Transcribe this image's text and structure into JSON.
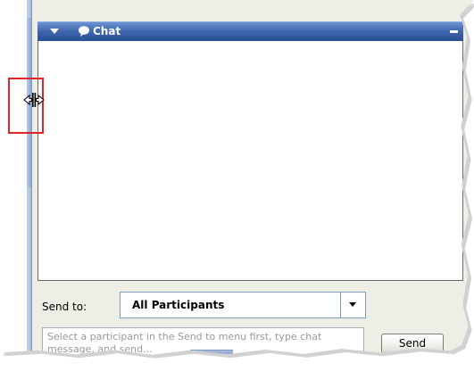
{
  "chat_panel": {
    "title": "Chat",
    "title_icon": "speech-bubble-icon",
    "collapse_icon": "triangle-down-icon",
    "minimize_icon": "minimize-icon"
  },
  "footer": {
    "send_to_label": "Send to:",
    "send_to_value": "All Participants",
    "dropdown_icon": "chevron-down-icon",
    "message_placeholder": "Select a participant in the Send to menu first, type chat message, and send...",
    "send_button_label": "Send"
  },
  "annotation": {
    "cursor_icon": "column-resize-cursor-icon",
    "highlight_color": "#e0262b"
  },
  "colors": {
    "titlebar": "#3e64ad",
    "panel_bg": "#eeeee6"
  }
}
